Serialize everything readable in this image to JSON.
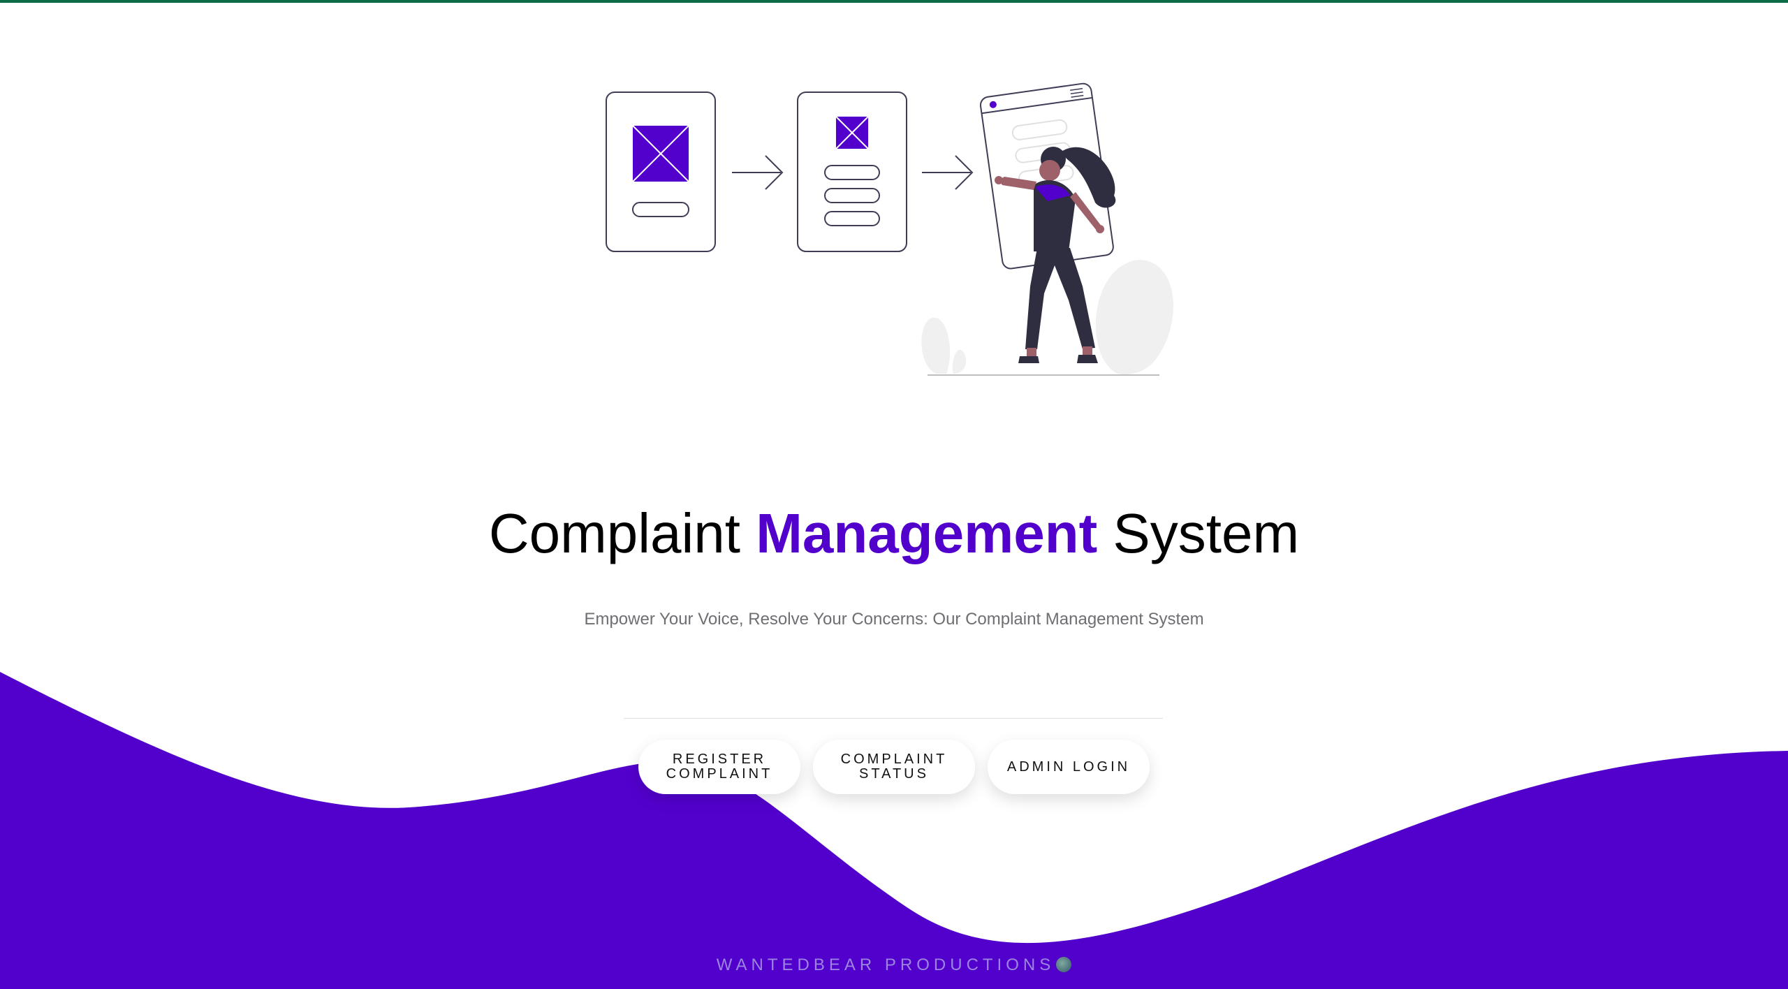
{
  "hero": {
    "title_part1": "Complaint ",
    "title_accent": "Management",
    "title_part2": " System",
    "subtitle": "Empower Your Voice, Resolve Your Concerns: Our Complaint Management System"
  },
  "actions": {
    "register_label": "REGISTER COMPLAINT",
    "status_label": "COMPLAINT STATUS",
    "admin_label": "ADMIN LOGIN"
  },
  "footer": {
    "credit": "WANTEDBEAR PRODUCTIONS",
    "icon": "globe-icon"
  },
  "colors": {
    "accent": "#5200cc",
    "top_bar": "#0b6b45",
    "subtitle": "#6e6e73",
    "footer_text": "#9c85e0"
  }
}
